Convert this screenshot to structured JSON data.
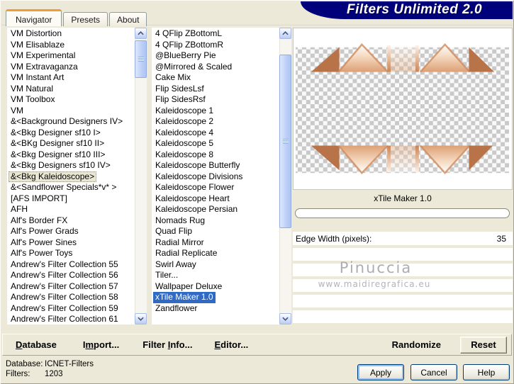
{
  "window": {
    "banner_title": "Filters Unlimited 2.0",
    "active_tab": "Navigator",
    "tabs": {
      "navigator": "Navigator",
      "presets": "Presets",
      "about": "About"
    }
  },
  "category_list": {
    "items": [
      "VM Distortion",
      "VM Elisablaze",
      "VM Experimental",
      "VM Extravaganza",
      "VM Instant Art",
      "VM Natural",
      "VM Toolbox",
      "VM",
      "&<Background Designers IV>",
      "&<Bkg Designer sf10 I>",
      "&<BKg Designer sf10 II>",
      "&<Bkg Designer sf10 III>",
      "&<Bkg Designers sf10 IV>",
      "&<Bkg Kaleidoscope>",
      "&<Sandflower Specials*v* >",
      "[AFS IMPORT]",
      "AFH",
      "Alf's Border FX",
      "Alf's Power Grads",
      "Alf's Power Sines",
      "Alf's Power Toys",
      "Andrew's Filter Collection 55",
      "Andrew's Filter Collection 56",
      "Andrew's Filter Collection 57",
      "Andrew's Filter Collection 58",
      "Andrew's Filter Collection 59",
      "Andrew's Filter Collection 61"
    ],
    "selected_index": 13
  },
  "filter_list": {
    "items": [
      "4 QFlip ZBottomL",
      "4 QFlip ZBottomR",
      "@BlueBerry Pie",
      "@Mirrored & Scaled",
      "Cake Mix",
      "Flip SidesLsf",
      "Flip SidesRsf",
      "Kaleidoscope 1",
      "Kaleidoscope 2",
      "Kaleidoscope 4",
      "Kaleidoscope 5",
      "Kaleidoscope 8",
      "Kaleidoscope Butterfly",
      "Kaleidoscope Divisions",
      "Kaleidoscope Flower",
      "Kaleidoscope Heart",
      "Kaleidoscope Persian",
      "Nomads Rug",
      "Quad Flip",
      "Radial Mirror",
      "Radial Replicate",
      "Swirl Away",
      "Tiler...",
      "Wallpaper Deluxe",
      "xTile Maker 1.0",
      "Zandflower"
    ],
    "selected_index": 24
  },
  "preview": {
    "selected_filter_label": "xTile Maker 1.0"
  },
  "parameters": {
    "edge_width_label": "Edge Width (pixels):",
    "edge_width_value": "35"
  },
  "watermark": {
    "name": "Pinuccia",
    "url": "www.maidiregrafica.eu"
  },
  "toolbar": {
    "database": {
      "label": "Database",
      "u": 0
    },
    "import": {
      "label": "Import...",
      "u": 1
    },
    "filter_info": {
      "label": "Filter Info...",
      "u": 7
    },
    "editor": {
      "label": "Editor...",
      "u": 0
    },
    "randomize": "Randomize",
    "reset": "Reset"
  },
  "status": {
    "database_label": "Database:",
    "database_value": "ICNET-Filters",
    "filters_label": "Filters:",
    "filters_value": "1203"
  },
  "dialog_buttons": {
    "apply": "Apply",
    "cancel": "Cancel",
    "help": "Help"
  },
  "colors": {
    "banner_navy": "#00007b",
    "selection_blue": "#316ac5",
    "dialog_beige": "#ece9d8",
    "copper_solid": "#b97348",
    "tab_accent_orange": "#ef9c33"
  }
}
